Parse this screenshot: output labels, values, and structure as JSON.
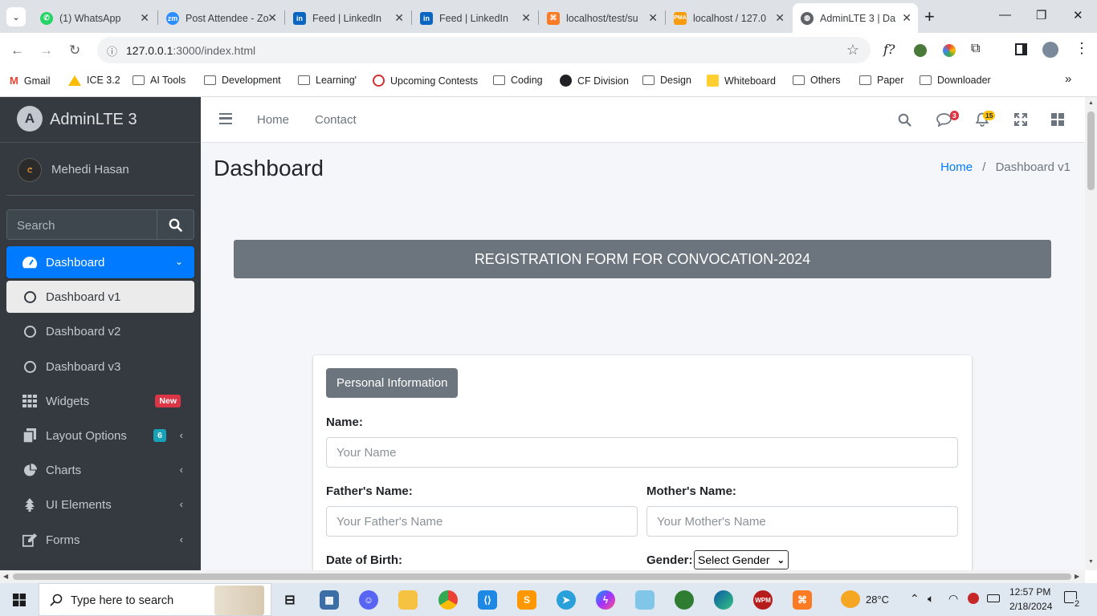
{
  "browser": {
    "tabs": [
      {
        "title": "(1) WhatsApp",
        "favicon": "whatsapp-icon",
        "color": "#25d366"
      },
      {
        "title": "Post Attendee - Zoom",
        "favicon": "zoom-icon",
        "color": "#2d8cff"
      },
      {
        "title": "Feed | LinkedIn",
        "favicon": "linkedin-icon",
        "color": "#0a66c2"
      },
      {
        "title": "Feed | LinkedIn",
        "favicon": "linkedin-icon",
        "color": "#0a66c2"
      },
      {
        "title": "localhost/test/su",
        "favicon": "xampp-icon",
        "color": "#fb7a24"
      },
      {
        "title": "localhost / 127.0",
        "favicon": "phpmyadmin-icon",
        "color": "#f89c0e"
      },
      {
        "title": "AdminLTE 3 | Da",
        "favicon": "globe-icon",
        "color": "#5f6368"
      }
    ],
    "url_host": "127.0.0.1",
    "url_rest": ":3000/index.html",
    "bookmarks": [
      {
        "label": "Gmail",
        "icon": "gmail-icon"
      },
      {
        "label": "ICE 3.2",
        "icon": "drive-icon"
      },
      {
        "label": "AI Tools",
        "icon": "folder-icon"
      },
      {
        "label": "Development",
        "icon": "folder-icon"
      },
      {
        "label": "Learning'",
        "icon": "folder-icon"
      },
      {
        "label": "Upcoming Contests",
        "icon": "clist-icon"
      },
      {
        "label": "Coding",
        "icon": "folder-icon"
      },
      {
        "label": "CF Division",
        "icon": "globe-icon"
      },
      {
        "label": "Design",
        "icon": "folder-icon"
      },
      {
        "label": "Whiteboard",
        "icon": "miro-icon"
      },
      {
        "label": "Others",
        "icon": "folder-icon"
      },
      {
        "label": "Paper",
        "icon": "folder-icon"
      },
      {
        "label": "Downloader",
        "icon": "folder-icon"
      }
    ]
  },
  "sidebar": {
    "brand": "AdminLTE 3",
    "user_name": "Mehedi Hasan",
    "search_placeholder": "Search",
    "items": [
      {
        "label": "Dashboard",
        "icon": "tachometer-icon",
        "active": true
      },
      {
        "label": "Dashboard v1",
        "icon": "circle-icon"
      },
      {
        "label": "Dashboard v2",
        "icon": "circle-icon"
      },
      {
        "label": "Dashboard v3",
        "icon": "circle-icon"
      },
      {
        "label": "Widgets",
        "icon": "grid-icon",
        "badge": "New"
      },
      {
        "label": "Layout Options",
        "icon": "copy-icon",
        "badge": "6"
      },
      {
        "label": "Charts",
        "icon": "pie-chart-icon"
      },
      {
        "label": "UI Elements",
        "icon": "tree-icon"
      },
      {
        "label": "Forms",
        "icon": "edit-icon"
      }
    ]
  },
  "topnav": {
    "home": "Home",
    "contact": "Contact",
    "messages_count": "3",
    "notifications_count": "15"
  },
  "content": {
    "page_title": "Dashboard",
    "breadcrumb_home": "Home",
    "breadcrumb_separator": "/",
    "breadcrumb_current": "Dashboard v1",
    "banner": "REGISTRATION FORM FOR CONVOCATION-2024",
    "section_button": "Personal Information",
    "name_label": "Name:",
    "name_placeholder": "Your Name",
    "father_label": "Father's Name:",
    "father_placeholder": "Your Father's Name",
    "mother_label": "Mother's Name:",
    "mother_placeholder": "Your Mother's Name",
    "dob_label": "Date of Birth:",
    "gender_label": "Gender:",
    "gender_selected": "Select Gender"
  },
  "taskbar": {
    "search_placeholder": "Type here to search",
    "weather": "28°C",
    "time": "12:57 PM",
    "date": "2/18/2024",
    "notifications": "2"
  },
  "colors": {
    "sidebar_bg": "#343a40",
    "active_blue": "#007bff",
    "banner_gray": "#6c757d",
    "badge_red": "#dc3545",
    "badge_cyan": "#17a2b8",
    "badge_yellow": "#ffc107"
  }
}
